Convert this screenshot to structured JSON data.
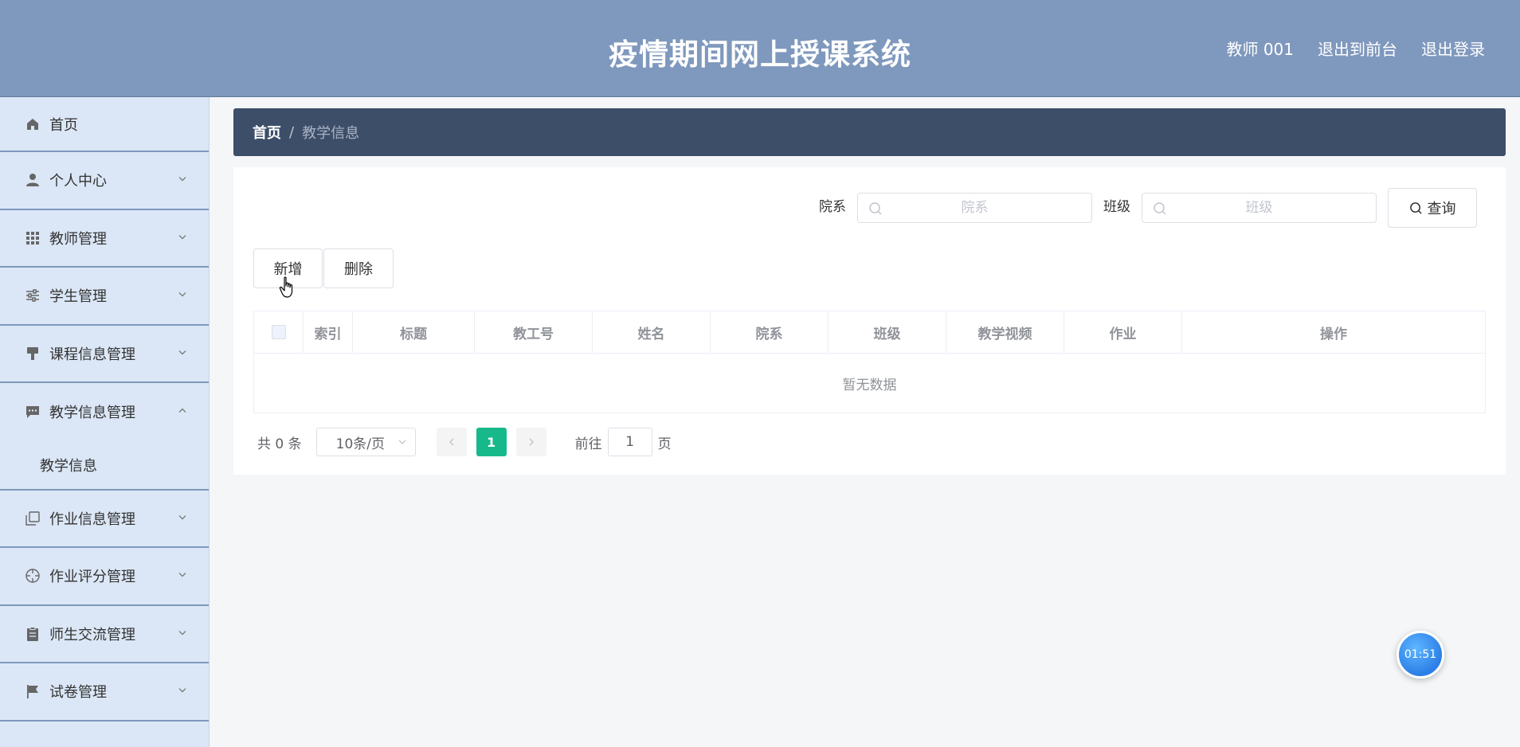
{
  "header": {
    "title": "疫情期间网上授课系统",
    "user": "教师 001",
    "nav_front": "退出到前台",
    "nav_logout": "退出登录",
    "bg_color": "#7f98bd"
  },
  "sidebar": {
    "items": [
      {
        "label": "首页",
        "icon": "home-icon"
      },
      {
        "label": "个人中心",
        "icon": "user-icon"
      },
      {
        "label": "教师管理",
        "icon": "grid-icon"
      },
      {
        "label": "学生管理",
        "icon": "sliders-icon"
      },
      {
        "label": "课程信息管理",
        "icon": "brush-icon"
      },
      {
        "label": "教学信息管理",
        "icon": "chat-icon",
        "expanded": true
      },
      {
        "label": "作业信息管理",
        "icon": "copy-icon"
      },
      {
        "label": "作业评分管理",
        "icon": "compass-icon"
      },
      {
        "label": "师生交流管理",
        "icon": "clipboard-icon"
      },
      {
        "label": "试卷管理",
        "icon": "flag-icon"
      }
    ],
    "subitem": "教学信息"
  },
  "breadcrumb": {
    "home": "首页",
    "separator": "/",
    "current": "教学信息"
  },
  "search": {
    "dept_label": "院系",
    "dept_placeholder": "院系",
    "class_label": "班级",
    "class_placeholder": "班级",
    "query_label": "查询"
  },
  "actions": {
    "add_label": "新增",
    "delete_label": "删除"
  },
  "table": {
    "columns": [
      "索引",
      "标题",
      "教工号",
      "姓名",
      "院系",
      "班级",
      "教学视频",
      "作业",
      "操作"
    ],
    "empty_text": "暂无数据"
  },
  "pagination": {
    "total": "共 0 条",
    "page_size": "10条/页",
    "current_page": "1",
    "goto_label": "前往",
    "goto_value": "1",
    "page_suffix": "页",
    "active_color": "#17b98b"
  },
  "timer": {
    "text": "01:51"
  }
}
